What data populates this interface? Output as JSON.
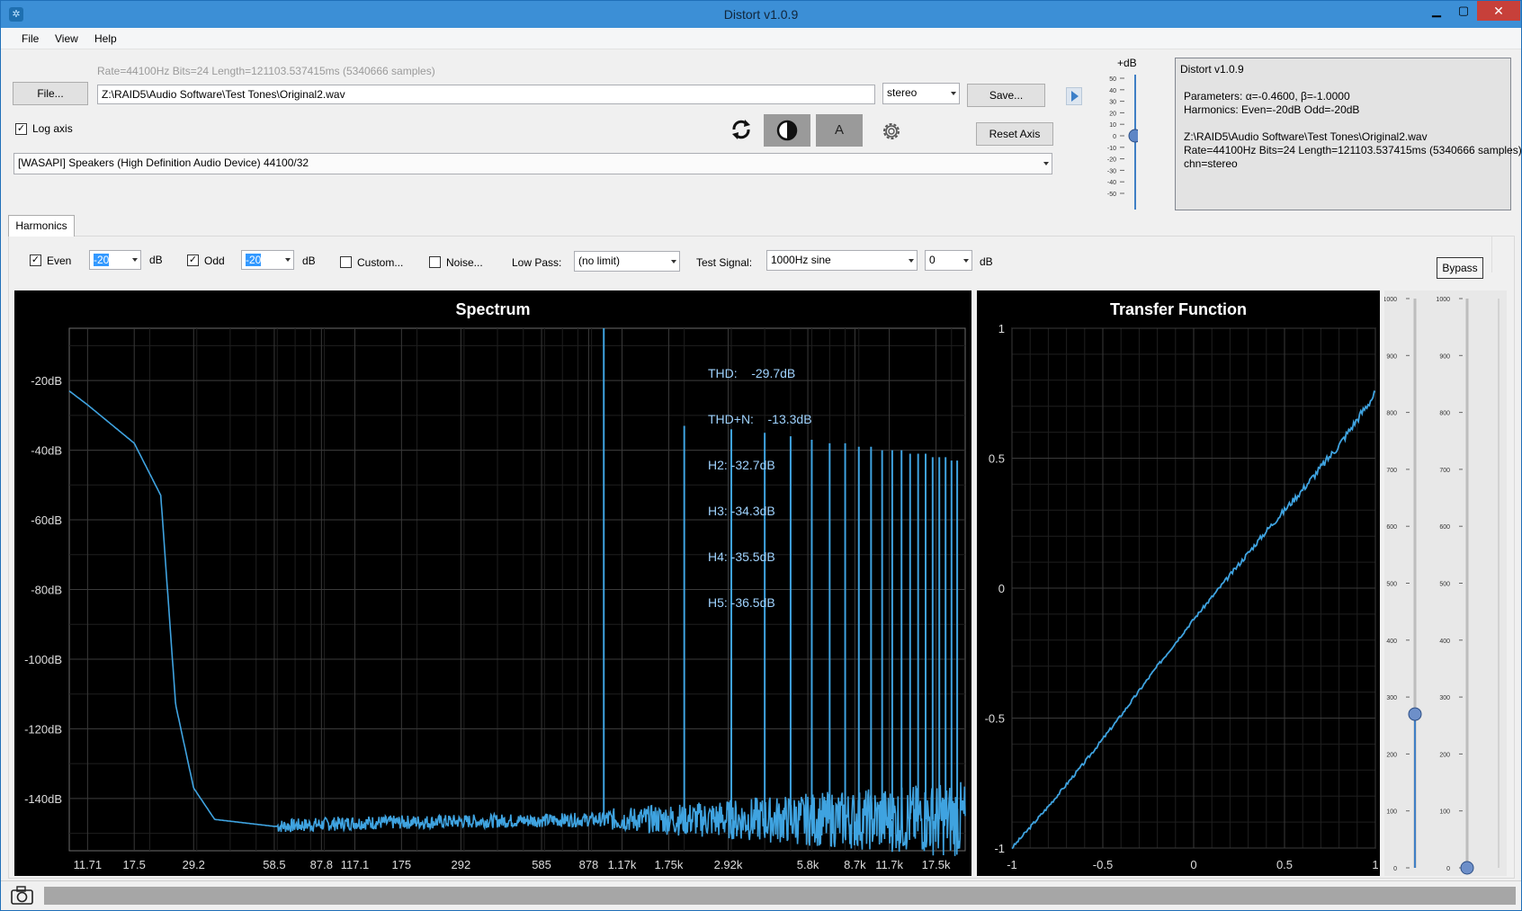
{
  "window": {
    "title": "Distort v1.0.9"
  },
  "menu": [
    "File",
    "View",
    "Help"
  ],
  "file": {
    "info": "Rate=44100Hz Bits=24 Length=121103.537415ms (5340666 samples)",
    "button": "File...",
    "path": "Z:\\RAID5\\Audio Software\\Test Tones\\Original2.wav",
    "channel": "stereo",
    "save": "Save...",
    "reset_axis": "Reset Axis"
  },
  "log_axis": {
    "label": "Log axis",
    "checked": true
  },
  "toolbar": {
    "reload_icon": "refresh-icon",
    "contrast_icon": "contrast-icon",
    "a_label": "A",
    "settings_icon": "gear-icon"
  },
  "device": "[WASAPI] Speakers (High Definition Audio Device) 44100/32",
  "gain": {
    "label": "+dB",
    "ticks": [
      "50",
      "40",
      "30",
      "20",
      "10",
      "0",
      "-10",
      "-20",
      "-30",
      "-40",
      "-50"
    ],
    "value": 0
  },
  "info_panel": {
    "lines": [
      "Distort v1.0.9",
      "",
      "Parameters: α=-0.4600, β=-1.0000",
      "Harmonics: Even=-20dB Odd=-20dB",
      "",
      "Z:\\RAID5\\Audio Software\\Test Tones\\Original2.wav",
      "Rate=44100Hz Bits=24 Length=121103.537415ms (5340666 samples)",
      "chn=stereo"
    ]
  },
  "tab": "Harmonics",
  "harmonics": {
    "even_label": "Even",
    "even_checked": true,
    "even_value": "-20",
    "even_unit": "dB",
    "odd_label": "Odd",
    "odd_checked": true,
    "odd_value": "-20",
    "odd_unit": "dB",
    "custom_label": "Custom...",
    "custom_checked": false,
    "noise_label": "Noise...",
    "noise_checked": false,
    "lowpass_label": "Low Pass:",
    "lowpass_value": "(no limit)",
    "test_signal_label": "Test Signal:",
    "test_signal_value": "1000Hz sine",
    "level_value": "0",
    "level_unit": "dB",
    "bypass": "Bypass"
  },
  "spectrum": {
    "title": "Spectrum",
    "stats": [
      "THD:    -29.7dB",
      "THD+N:    -13.3dB",
      "H2: -32.7dB",
      "H3: -34.3dB",
      "H4: -35.5dB",
      "H5: -36.5dB"
    ],
    "y_ticks": [
      "-20dB",
      "-40dB",
      "-60dB",
      "-80dB",
      "-100dB",
      "-120dB",
      "-140dB"
    ],
    "x_ticks": [
      "11.71",
      "17.5",
      "29.2",
      "58.5",
      "87.8",
      "117.1",
      "175",
      "292",
      "585",
      "878",
      "1.17k",
      "1.75k",
      "2.92k",
      "5.8k",
      "8.7k",
      "11.7k",
      "17.5k"
    ],
    "color": "#3fa3e0"
  },
  "transfer": {
    "title": "Transfer Function",
    "y_ticks": [
      "1",
      "0.5",
      "0",
      "-0.5",
      "-1"
    ],
    "x_ticks": [
      "-1",
      "-0.5",
      "0",
      "0.5",
      "1"
    ]
  },
  "side_sliders": {
    "ticks": [
      "1000",
      "900",
      "800",
      "700",
      "600",
      "500",
      "400",
      "300",
      "200",
      "100",
      "0"
    ],
    "left_value": 270,
    "right_value": 0
  },
  "chart_data": [
    {
      "type": "line",
      "title": "Spectrum",
      "xlabel": "",
      "ylabel": "",
      "x_scale": "log",
      "ylim": [
        -155,
        -5
      ],
      "x": [
        10,
        11.71,
        17.5,
        22,
        25,
        29.2,
        35,
        58.5,
        87.8,
        117.1,
        175,
        292,
        585,
        900,
        1000,
        1100,
        2000,
        3000,
        4000,
        5000,
        22000
      ],
      "y": [
        -23,
        -27,
        -38,
        -53,
        -113,
        -137,
        -146,
        -148,
        -147,
        -147,
        -146,
        -146,
        -146,
        -146,
        -5,
        -146,
        -33,
        -34,
        -35,
        -36,
        -43
      ],
      "harmonics_hz": [
        1000,
        2000,
        3000,
        4000,
        5000,
        6000,
        7000,
        8000,
        9000,
        10000,
        11000,
        12000,
        13000,
        14000,
        15000,
        16000,
        17000,
        18000,
        19000,
        20000,
        21000
      ],
      "harmonics_db": [
        -5,
        -33,
        -34,
        -35,
        -36,
        -37,
        -38,
        -38,
        -39,
        -39,
        -40,
        -40,
        -40,
        -41,
        -41,
        -41,
        -42,
        -42,
        -42,
        -43,
        -43
      ]
    },
    {
      "type": "line",
      "title": "Transfer Function",
      "xlabel": "",
      "ylabel": "",
      "xlim": [
        -1,
        1
      ],
      "ylim": [
        -1,
        1
      ],
      "x": [
        -1,
        -0.8,
        -0.6,
        -0.4,
        -0.2,
        0,
        0.2,
        0.4,
        0.6,
        0.8,
        0.9,
        1
      ],
      "y": [
        -1,
        -0.84,
        -0.67,
        -0.49,
        -0.3,
        -0.12,
        0.05,
        0.22,
        0.38,
        0.55,
        0.65,
        0.75
      ]
    }
  ]
}
